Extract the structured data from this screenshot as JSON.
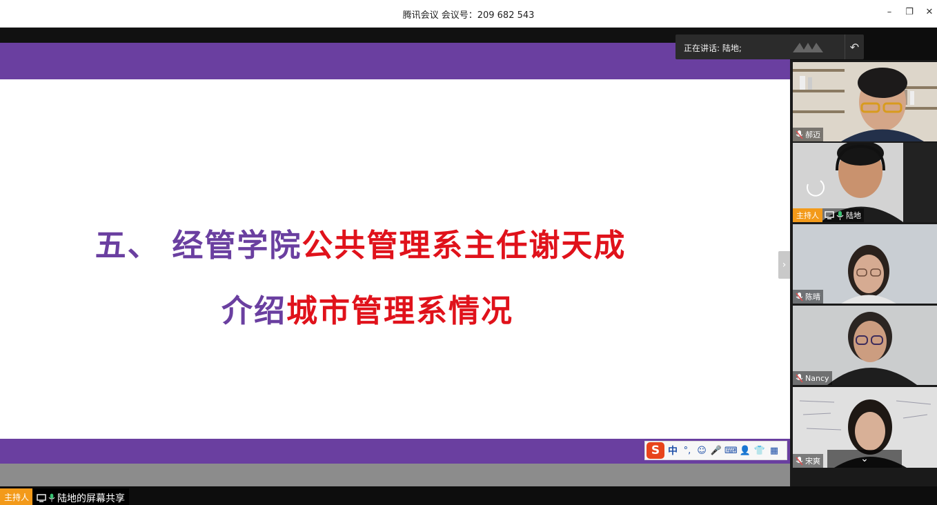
{
  "window": {
    "title": "腾讯会议 会议号：209 682 543",
    "minimize": "–",
    "restore": "❐",
    "close": "✕"
  },
  "slide": {
    "line1_purple": "五、 经管学院",
    "line1_red": "公共管理系主任谢天成",
    "line2_purple": "介绍",
    "line2_red": "城市管理系情况",
    "purple_color": "#6a3fa0",
    "red_color": "#e0121b"
  },
  "speaking": {
    "label": "正在讲话: 陆地;"
  },
  "ime": {
    "logo": "S",
    "mode": "中",
    "punct": "°,",
    "emoji": "☺",
    "voice": "🎤",
    "keyboard": "⌨",
    "user": "👤",
    "skin": "👕",
    "apps": "▦"
  },
  "participants": [
    {
      "name": "郝迈",
      "host": false
    },
    {
      "name": "陆地",
      "host": true,
      "host_label": "主持人"
    },
    {
      "name": "陈晴",
      "host": false
    },
    {
      "name": "Nancy",
      "host": false
    },
    {
      "name": "宋爽",
      "host": false
    }
  ],
  "footer": {
    "host_label": "主持人",
    "share_label": "陆地的屏幕共享"
  },
  "colors": {
    "host_badge": "#f39a1a",
    "mic_muted": "#e05050",
    "mic_active": "#38c172"
  }
}
